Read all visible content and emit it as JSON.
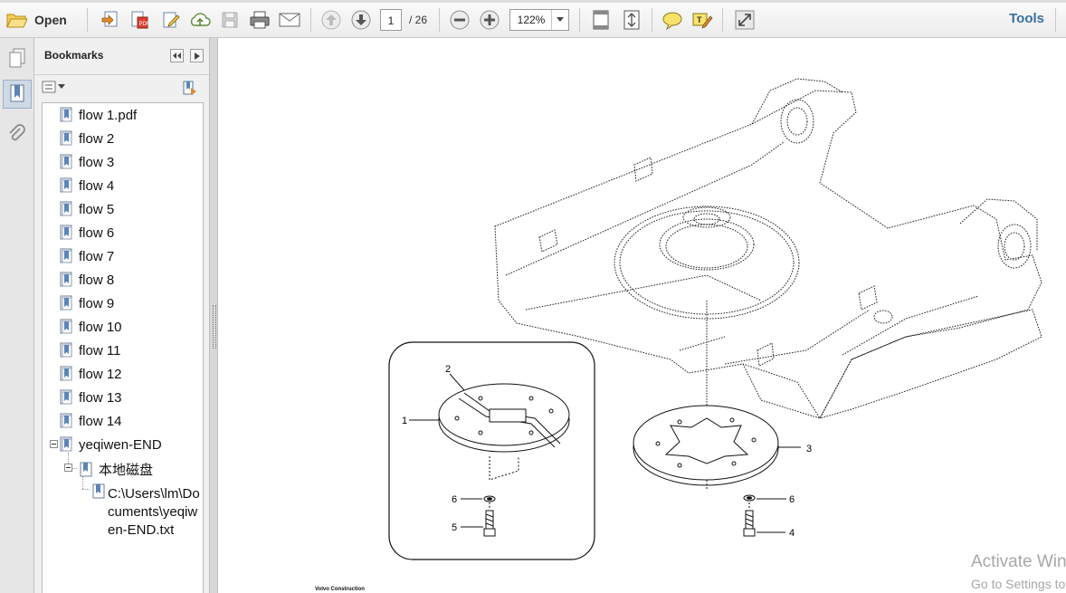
{
  "toolbar": {
    "open_label": "Open",
    "current_page": "1",
    "page_total": "/ 26",
    "zoom": "122%",
    "tools_label": "Tools",
    "icons": [
      "folder-open-icon",
      "create-pdf-icon",
      "convert-icon",
      "edit-icon",
      "cloud-upload-icon",
      "save-icon",
      "print-icon",
      "email-icon",
      "page-up-icon",
      "page-down-icon",
      "zoom-out-icon",
      "zoom-in-icon",
      "fit-page-icon",
      "fit-width-icon",
      "comment-icon",
      "highlight-icon",
      "fullscreen-icon"
    ]
  },
  "rail": {
    "icons": [
      "pages-icon",
      "bookmark-icon",
      "paperclip-icon"
    ]
  },
  "bookmarks": {
    "title": "Bookmarks",
    "items": [
      {
        "label": "flow 1.pdf"
      },
      {
        "label": "flow 2"
      },
      {
        "label": "flow 3"
      },
      {
        "label": "flow 4"
      },
      {
        "label": "flow 5"
      },
      {
        "label": "flow 6"
      },
      {
        "label": "flow 7"
      },
      {
        "label": "flow 8"
      },
      {
        "label": "flow 9"
      },
      {
        "label": "flow 10"
      },
      {
        "label": "flow 11"
      },
      {
        "label": "flow 12"
      },
      {
        "label": "flow 13"
      },
      {
        "label": "flow 14"
      },
      {
        "label": "yeqiwen-END"
      }
    ],
    "child": {
      "label": "本地磁盘"
    },
    "grandchild": {
      "line1": "C:\\Users\\lm\\Do",
      "line2": "cuments\\yeqiw",
      "line3": "en-END.txt"
    }
  },
  "document": {
    "callouts": [
      "2",
      "1",
      "6",
      "5",
      "3",
      "6",
      "4"
    ],
    "footer": "Volvo Construction",
    "watermark_line1": "Activate Windows",
    "watermark_line2": "Go to Settings to activate Windows."
  }
}
